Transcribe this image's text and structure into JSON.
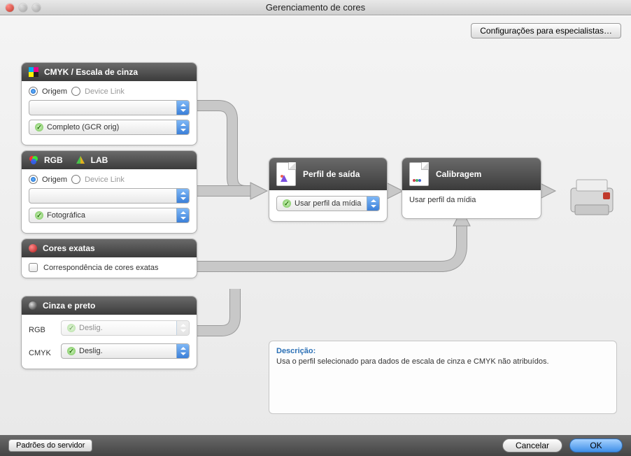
{
  "window": {
    "title": "Gerenciamento de cores"
  },
  "expert_button": "Configurações para especialistas…",
  "panels": {
    "cmyk": {
      "title": "CMYK / Escala de cinza",
      "radio_origin": "Origem",
      "radio_devicelink": "Device Link",
      "combo1": "",
      "combo2": "Completo (GCR orig)"
    },
    "rgb": {
      "title_rgb": "RGB",
      "title_lab": "LAB",
      "radio_origin": "Origem",
      "radio_devicelink": "Device Link",
      "combo1": "",
      "combo2": "Fotográfica"
    },
    "spot": {
      "title": "Cores exatas",
      "checkbox": "Correspondência de cores exatas"
    },
    "gray": {
      "title": "Cinza e preto",
      "row_rgb": "RGB",
      "row_cmyk": "CMYK",
      "combo_rgb": "Deslig.",
      "combo_cmyk": "Deslig."
    },
    "output": {
      "title": "Perfil de saída",
      "combo": "Usar perfil da mídia"
    },
    "calib": {
      "title": "Calibragem",
      "text": "Usar perfil da mídia"
    }
  },
  "description": {
    "heading": "Descrição:",
    "text": "Usa o perfil selecionado para dados de escala de cinza e CMYK não atribuídos."
  },
  "footer": {
    "server_defaults": "Padrões do servidor",
    "cancel": "Cancelar",
    "ok": "OK"
  }
}
